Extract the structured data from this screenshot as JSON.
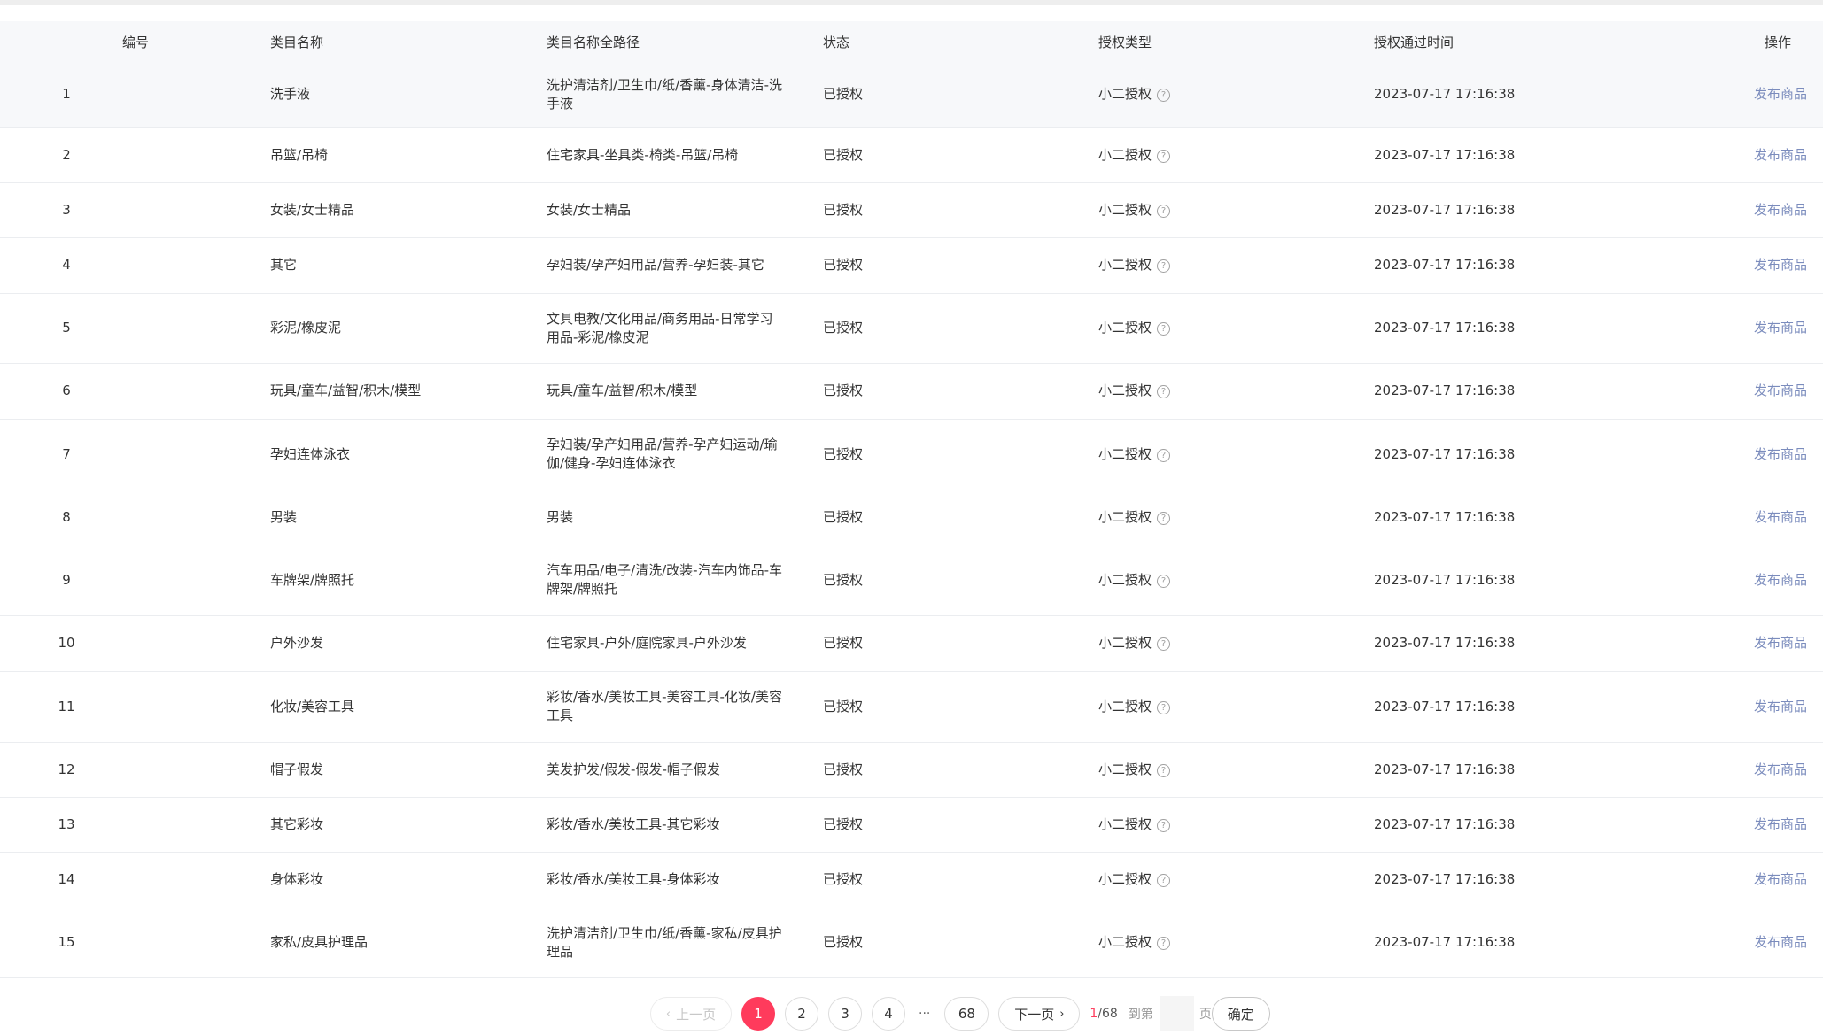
{
  "table": {
    "headers": {
      "id": "编号",
      "name": "类目名称",
      "path": "类目名称全路径",
      "status": "状态",
      "auth_type": "授权类型",
      "auth_time": "授权通过时间",
      "ops": "操作"
    },
    "help_icon": "question-circle-icon",
    "rows": [
      {
        "id": "1",
        "name": "洗手液",
        "path": "洗护清洁剂/卫生巾/纸/香薰-身体清洁-洗手液",
        "status": "已授权",
        "auth_type": "小二授权",
        "auth_time": "2023-07-17 17:16:38",
        "op": "发布商品"
      },
      {
        "id": "2",
        "name": "吊篮/吊椅",
        "path": "住宅家具-坐具类-椅类-吊篮/吊椅",
        "status": "已授权",
        "auth_type": "小二授权",
        "auth_time": "2023-07-17 17:16:38",
        "op": "发布商品"
      },
      {
        "id": "3",
        "name": "女装/女士精品",
        "path": "女装/女士精品",
        "status": "已授权",
        "auth_type": "小二授权",
        "auth_time": "2023-07-17 17:16:38",
        "op": "发布商品"
      },
      {
        "id": "4",
        "name": "其它",
        "path": "孕妇装/孕产妇用品/营养-孕妇装-其它",
        "status": "已授权",
        "auth_type": "小二授权",
        "auth_time": "2023-07-17 17:16:38",
        "op": "发布商品"
      },
      {
        "id": "5",
        "name": "彩泥/橡皮泥",
        "path": "文具电教/文化用品/商务用品-日常学习用品-彩泥/橡皮泥",
        "status": "已授权",
        "auth_type": "小二授权",
        "auth_time": "2023-07-17 17:16:38",
        "op": "发布商品"
      },
      {
        "id": "6",
        "name": "玩具/童车/益智/积木/模型",
        "path": "玩具/童车/益智/积木/模型",
        "status": "已授权",
        "auth_type": "小二授权",
        "auth_time": "2023-07-17 17:16:38",
        "op": "发布商品"
      },
      {
        "id": "7",
        "name": "孕妇连体泳衣",
        "path": "孕妇装/孕产妇用品/营养-孕产妇运动/瑜伽/健身-孕妇连体泳衣",
        "status": "已授权",
        "auth_type": "小二授权",
        "auth_time": "2023-07-17 17:16:38",
        "op": "发布商品"
      },
      {
        "id": "8",
        "name": "男装",
        "path": "男装",
        "status": "已授权",
        "auth_type": "小二授权",
        "auth_time": "2023-07-17 17:16:38",
        "op": "发布商品"
      },
      {
        "id": "9",
        "name": "车牌架/牌照托",
        "path": "汽车用品/电子/清洗/改装-汽车内饰品-车牌架/牌照托",
        "status": "已授权",
        "auth_type": "小二授权",
        "auth_time": "2023-07-17 17:16:38",
        "op": "发布商品"
      },
      {
        "id": "10",
        "name": "户外沙发",
        "path": "住宅家具-户外/庭院家具-户外沙发",
        "status": "已授权",
        "auth_type": "小二授权",
        "auth_time": "2023-07-17 17:16:38",
        "op": "发布商品"
      },
      {
        "id": "11",
        "name": "化妆/美容工具",
        "path": "彩妆/香水/美妆工具-美容工具-化妆/美容工具",
        "status": "已授权",
        "auth_type": "小二授权",
        "auth_time": "2023-07-17 17:16:38",
        "op": "发布商品"
      },
      {
        "id": "12",
        "name": "帽子假发",
        "path": "美发护发/假发-假发-帽子假发",
        "status": "已授权",
        "auth_type": "小二授权",
        "auth_time": "2023-07-17 17:16:38",
        "op": "发布商品"
      },
      {
        "id": "13",
        "name": "其它彩妆",
        "path": "彩妆/香水/美妆工具-其它彩妆",
        "status": "已授权",
        "auth_type": "小二授权",
        "auth_time": "2023-07-17 17:16:38",
        "op": "发布商品"
      },
      {
        "id": "14",
        "name": "身体彩妆",
        "path": "彩妆/香水/美妆工具-身体彩妆",
        "status": "已授权",
        "auth_type": "小二授权",
        "auth_time": "2023-07-17 17:16:38",
        "op": "发布商品"
      },
      {
        "id": "15",
        "name": "家私/皮具护理品",
        "path": "洗护清洁剂/卫生巾/纸/香薰-家私/皮具护理品",
        "status": "已授权",
        "auth_type": "小二授权",
        "auth_time": "2023-07-17 17:16:38",
        "op": "发布商品"
      }
    ]
  },
  "pagination": {
    "prev": "上一页",
    "prev_icon": "chevron-left-icon",
    "pages": [
      "1",
      "2",
      "3",
      "4"
    ],
    "ellipsis": "···",
    "last_page": "68",
    "next": "下一页",
    "next_icon": "chevron-right-icon",
    "current": "1",
    "total": "/68",
    "goto_label": "到第",
    "page_unit": "页",
    "goto_value": "",
    "confirm": "确定"
  },
  "colors": {
    "accent": "#ff3b5c",
    "link": "#7b8cbd",
    "header_bg": "#f7f8fa"
  }
}
